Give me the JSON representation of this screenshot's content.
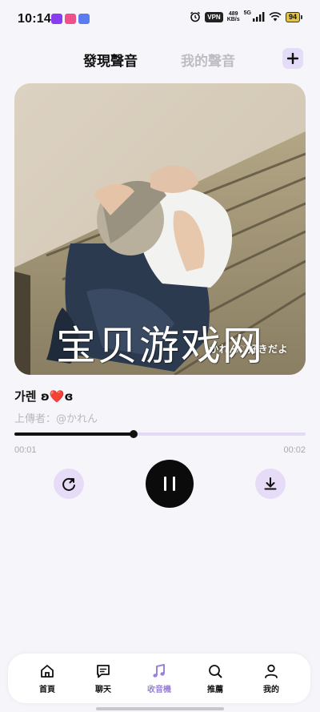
{
  "status_bar": {
    "time": "10:14",
    "vpn": "VPN",
    "net_speed": "489",
    "net_unit": "KB/s",
    "signal": "5G",
    "battery": "94"
  },
  "header": {
    "tabs": [
      {
        "label": "發現聲音",
        "active": true
      },
      {
        "label": "我的聲音",
        "active": false
      }
    ],
    "add_icon": "plus-icon"
  },
  "player": {
    "cover_caption": "かれん♡好きだよ",
    "watermark": "宝贝游戏网",
    "title": "가렌 ʚ❤️ɞ",
    "uploader": "上傳者：@かれん",
    "current_time": "00:01",
    "total_time": "00:02",
    "progress_fraction": 0.41,
    "colors": {
      "accent": "#9a82d8",
      "accent_soft": "#e6dcf8",
      "track": "#e3daf5"
    }
  },
  "bottom_nav": [
    {
      "label": "首頁",
      "icon": "home-icon",
      "active": false
    },
    {
      "label": "聊天",
      "icon": "chat-icon",
      "active": false
    },
    {
      "label": "收音機",
      "icon": "music-note-icon",
      "active": true
    },
    {
      "label": "推薦",
      "icon": "search-icon",
      "active": false
    },
    {
      "label": "我的",
      "icon": "user-icon",
      "active": false
    }
  ]
}
